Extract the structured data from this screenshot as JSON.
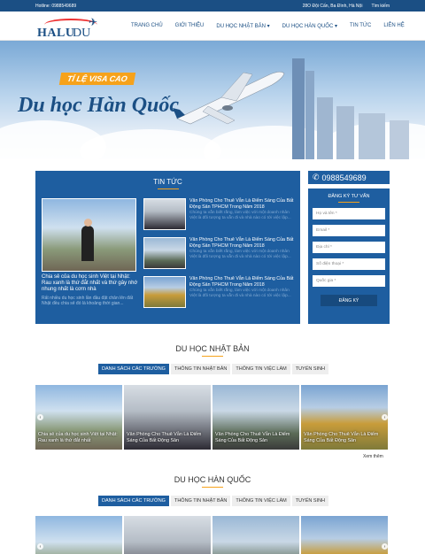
{
  "topbar": {
    "hotline": "Hotline: 0988549689",
    "address": "28O Đội Cấn, Ba Đình, Hà Nội",
    "search": "Tìm kiếm"
  },
  "logo": {
    "text1": "HALU",
    "text2": "DU HỌC"
  },
  "nav": [
    "TRANG CHỦ",
    "GIỚI THIỆU",
    "DU HỌC NHẬT BẢN ▾",
    "DU HỌC HÀN QUỐC ▾",
    "TIN TỨC",
    "LIÊN HỆ"
  ],
  "hero": {
    "badge": "TỈ LỆ VISA CAO",
    "title": "Du học Hàn Quốc"
  },
  "news": {
    "heading": "TIN TỨC",
    "featured": {
      "title": "Chia sẻ của du học sinh Việt tại Nhật: Rau xanh là thứ đắt nhất và thứ gây nhớ nhung nhất là cơm nhà",
      "desc": "Rất nhiều du học sinh lần đầu đặt chân lên đất Nhật đều chia sẻ đó là khoảng thời gian..."
    },
    "items": [
      {
        "title": "Văn Phòng Cho Thuê Vẫn Là Điểm Sáng Của Bất Động Sản TPHCM Trong Năm 2018",
        "desc": "Chúng ta vẫn biết rằng, làm việc với một doanh nhân Việt là đối tượng ta vẫn đi và nhà nào có tới việc lập..."
      },
      {
        "title": "Văn Phòng Cho Thuê Vẫn Là Điểm Sáng Của Bất Động Sản TPHCM Trong Năm 2018",
        "desc": "Chúng ta vẫn biết rằng, làm việc với một doanh nhân Việt là đối tượng ta vẫn đi và nhà nào có tới việc lập..."
      },
      {
        "title": "Văn Phòng Cho Thuê Vẫn Là Điểm Sáng Của Bất Động Sản TPHCM Trong Năm 2018",
        "desc": "Chúng ta vẫn biết rằng, làm việc với một doanh nhân Việt là đối tượng ta vẫn đi và nhà nào có tới việc lập..."
      }
    ]
  },
  "sidebar": {
    "phone": "0988549689",
    "form_title": "ĐĂNG KÝ TƯ VẤN",
    "fields": [
      "Họ và tên *",
      "Email *",
      "Địa chỉ *",
      "Số điện thoại *",
      "Quốc gia *"
    ],
    "submit": "ĐĂNG KÝ"
  },
  "section1": {
    "title": "DU HỌC NHẬT BẢN",
    "tabs": [
      "DANH SÁCH CÁC TRƯỜNG",
      "THÔNG TIN NHẬT BẢN",
      "THÔNG TIN VIỆC LÀM",
      "TUYỂN SINH"
    ],
    "cards": [
      "Chia sẻ của du học sinh Việt tại Nhật: Rau xanh là thứ đắt nhất",
      "Văn Phòng Cho Thuê Vẫn Là Điểm Sáng Của Bất Động Sản",
      "Văn Phòng Cho Thuê Vẫn Là Điểm Sáng Của Bất Động Sản",
      "Văn Phòng Cho Thuê Vẫn Là Điểm Sáng Của Bất Động Sản"
    ],
    "more": "Xem thêm"
  },
  "section2": {
    "title": "DU HỌC HÀN QUỐC",
    "tabs": [
      "DANH SÁCH CÁC TRƯỜNG",
      "THÔNG TIN NHẬT BẢN",
      "THÔNG TIN VIỆC LÀM",
      "TUYỂN SINH"
    ]
  }
}
